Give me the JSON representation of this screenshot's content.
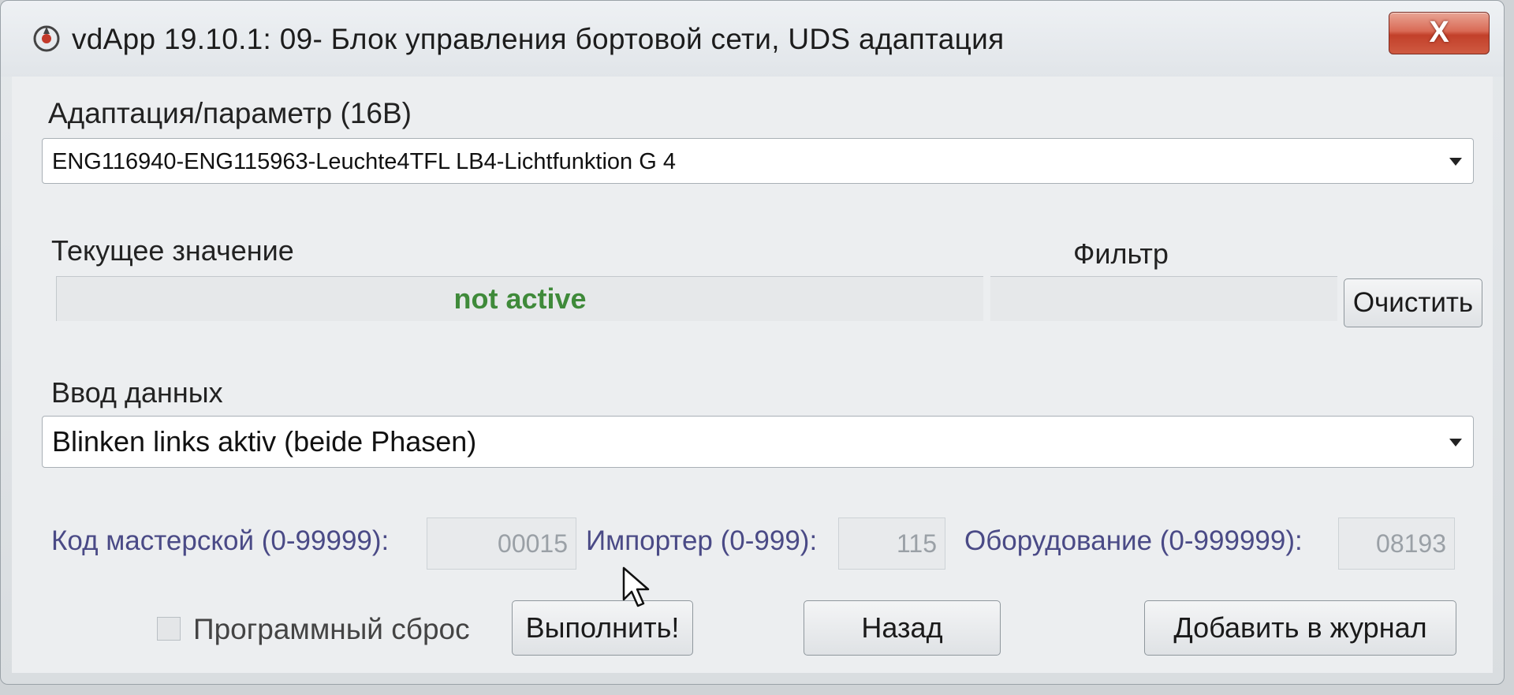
{
  "window": {
    "title": "vdApp 19.10.1: 09- Блок управления бортовой сети,  UDS адаптация",
    "close_label": "X"
  },
  "adaptation": {
    "label": "Адаптация/параметр (16В)",
    "selected": "ENG116940-ENG115963-Leuchte4TFL LB4-Lichtfunktion G 4"
  },
  "current_value": {
    "label": "Текущее значение",
    "value": "not active"
  },
  "filter": {
    "label": "Фильтр",
    "clear_button": "Очистить"
  },
  "data_input": {
    "label": "Ввод данных",
    "selected": "Blinken links aktiv (beide Phasen)"
  },
  "codes": {
    "workshop_label": "Код мастерской (0-99999):",
    "workshop_value": "00015",
    "importer_label": "Импортер (0-999):",
    "importer_value": "115",
    "equipment_label": "Оборудование (0-999999):",
    "equipment_value": "08193"
  },
  "actions": {
    "reset_label": "Программный сброс",
    "execute": "Выполнить!",
    "back": "Назад",
    "add_to_log": "Добавить в журнал"
  },
  "colors": {
    "active_value": "#3f8a3a",
    "code_labels": "#4a4a86",
    "close_button": "#c2402a"
  }
}
